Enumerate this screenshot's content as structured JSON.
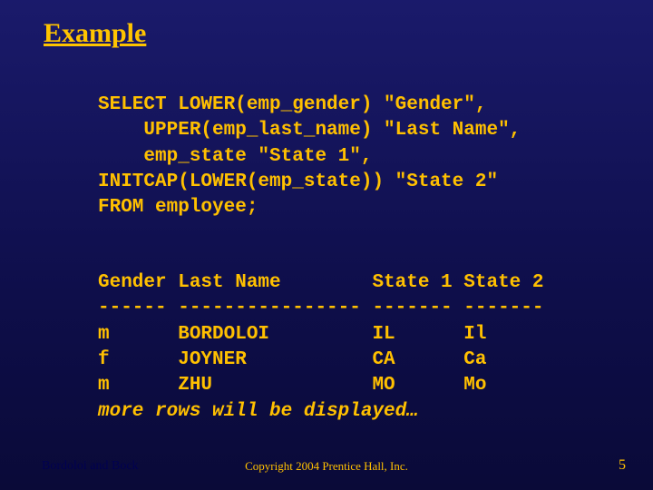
{
  "title": "Example",
  "code": {
    "l1": "SELECT LOWER(emp_gender) \"Gender\",",
    "l2": "    UPPER(emp_last_name) \"Last Name\",",
    "l3": "    emp_state \"State 1\",",
    "l4": "INITCAP(LOWER(emp_state)) \"State 2\"",
    "l5": "FROM employee;"
  },
  "result": {
    "header": "Gender Last Name        State 1 State 2",
    "rule": "------ ---------------- ------- -------",
    "r1": "m      BORDOLOI         IL      Il",
    "r2": "f      JOYNER           CA      Ca",
    "r3": "m      ZHU              MO      Mo",
    "more": "more rows will be displayed…"
  },
  "footer": {
    "left": "Bordoloi and Bock",
    "center": "Copyright 2004 Prentice Hall, Inc.",
    "right": "5"
  }
}
